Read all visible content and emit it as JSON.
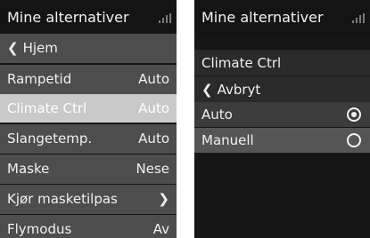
{
  "left_screen": {
    "title": "Mine alternativer",
    "signal_icon": "signal-icon",
    "items": [
      {
        "label": "Hjem",
        "icon": "chevron-left-icon"
      },
      {
        "label": "Rampetid",
        "value": "Auto"
      },
      {
        "label": "Climate Ctrl",
        "value": "Auto",
        "selected": true
      },
      {
        "label": "Slangetemp.",
        "value": "Auto"
      },
      {
        "label": "Maske",
        "value": "Nese"
      },
      {
        "label": "Kjør masketilpas",
        "icon": "chevron-right-icon"
      },
      {
        "label": "Flymodus",
        "value": "Av"
      }
    ]
  },
  "right_screen": {
    "title": "Mine alternativer",
    "signal_icon": "signal-icon",
    "header": "Climate Ctrl",
    "back_label": "Avbryt",
    "back_icon": "chevron-left-icon",
    "options": [
      {
        "label": "Auto",
        "checked": true
      },
      {
        "label": "Manuell",
        "checked": false,
        "highlighted": true
      }
    ]
  },
  "colors": {
    "screen_bg": "#161616",
    "row_bg": "#4d4d4d",
    "selected_row_bg": "#c9c9c9",
    "text": "#f0f0f0"
  }
}
